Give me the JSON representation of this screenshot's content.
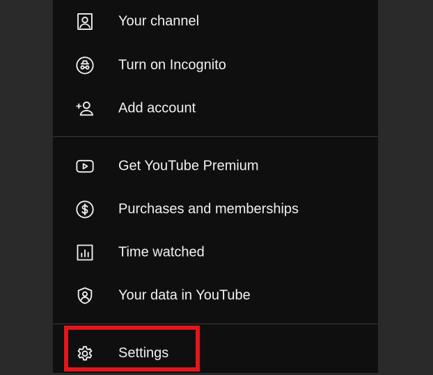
{
  "menu": {
    "section1": [
      {
        "label": "Your channel",
        "icon": "account-box-icon"
      },
      {
        "label": "Turn on Incognito",
        "icon": "incognito-icon"
      },
      {
        "label": "Add account",
        "icon": "add-person-icon"
      }
    ],
    "section2": [
      {
        "label": "Get YouTube Premium",
        "icon": "youtube-play-icon"
      },
      {
        "label": "Purchases and memberships",
        "icon": "dollar-circle-icon"
      },
      {
        "label": "Time watched",
        "icon": "bar-chart-icon"
      },
      {
        "label": "Your data in YouTube",
        "icon": "shield-person-icon"
      }
    ],
    "section3": [
      {
        "label": "Settings",
        "icon": "gear-icon"
      }
    ]
  },
  "colors": {
    "panel_background": "#0f0f0f",
    "outer_background": "#2a2a2a",
    "text": "#f1f1f1",
    "highlight_border": "#e3161c",
    "divider": "#3a3a3a"
  }
}
